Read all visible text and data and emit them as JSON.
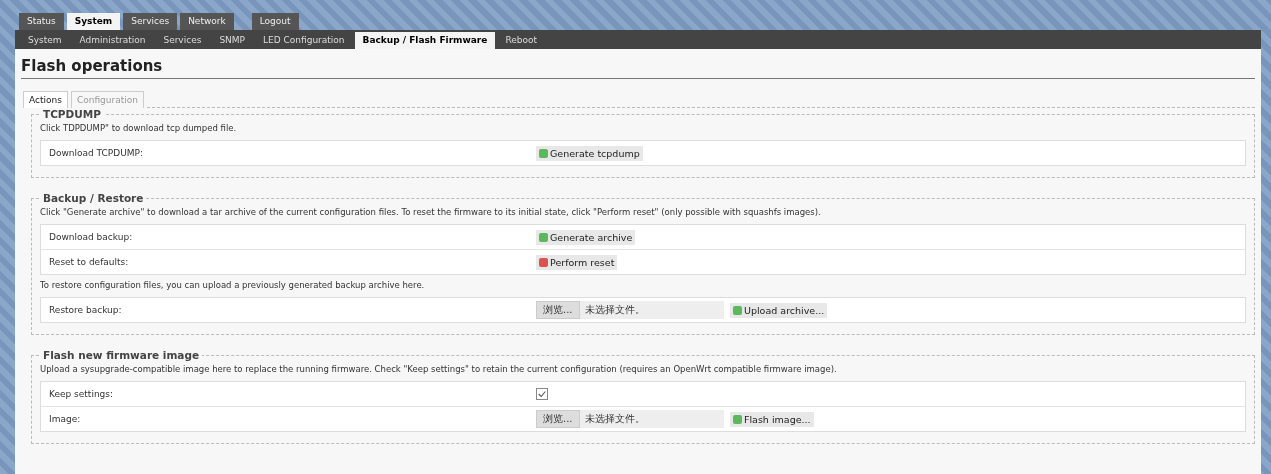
{
  "main_menu": [
    {
      "label": "Status",
      "selected": false
    },
    {
      "label": "System",
      "selected": true
    },
    {
      "label": "Services",
      "selected": false
    },
    {
      "label": "Network",
      "selected": false
    },
    {
      "label": "Logout",
      "selected": false
    }
  ],
  "sub_menu": [
    {
      "label": "System",
      "selected": false
    },
    {
      "label": "Administration",
      "selected": false
    },
    {
      "label": "Services",
      "selected": false
    },
    {
      "label": "SNMP",
      "selected": false
    },
    {
      "label": "LED Configuration",
      "selected": false
    },
    {
      "label": "Backup / Flash Firmware",
      "selected": true
    },
    {
      "label": "Reboot",
      "selected": false
    }
  ],
  "title": "Flash operations",
  "tabs": [
    {
      "label": "Actions",
      "selected": true
    },
    {
      "label": "Configuration",
      "selected": false
    }
  ],
  "sections": [
    {
      "legend": "TCPDUMP",
      "blocks": [
        {
          "kind": "text",
          "text": "Click TDPDUMP\" to download tcp dumped file."
        },
        {
          "kind": "table",
          "rows": [
            {
              "label": "Download TCPDUMP:",
              "kind": "button",
              "button": {
                "label": "Generate tcpdump",
                "color": "#5cb85c"
              }
            }
          ]
        }
      ]
    },
    {
      "legend": "Backup / Restore",
      "blocks": [
        {
          "kind": "text",
          "text": "Click \"Generate archive\" to download a tar archive of the current configuration files. To reset the firmware to its initial state, click \"Perform reset\" (only possible with squashfs images)."
        },
        {
          "kind": "table",
          "rows": [
            {
              "label": "Download backup:",
              "kind": "button",
              "button": {
                "label": "Generate archive",
                "color": "#5cb85c"
              }
            },
            {
              "label": "Reset to defaults:",
              "kind": "button",
              "button": {
                "label": "Perform reset",
                "color": "#d9534f"
              }
            }
          ]
        },
        {
          "kind": "text",
          "text": "To restore configuration files, you can upload a previously generated backup archive here."
        },
        {
          "kind": "table",
          "rows": [
            {
              "label": "Restore backup:",
              "kind": "file",
              "browse": "浏览...",
              "file_status": "未选择文件。",
              "button": {
                "label": "Upload archive...",
                "color": "#5cb85c"
              }
            }
          ]
        }
      ]
    },
    {
      "legend": "Flash new firmware image",
      "blocks": [
        {
          "kind": "text",
          "text": "Upload a sysupgrade-compatible image here to replace the running firmware. Check \"Keep settings\" to retain the current configuration (requires an OpenWrt compatible firmware image)."
        },
        {
          "kind": "table",
          "rows": [
            {
              "label": "Keep settings:",
              "kind": "checkbox",
              "checked": true
            },
            {
              "label": "Image:",
              "kind": "file",
              "browse": "浏览...",
              "file_status": "未选择文件。",
              "button": {
                "label": "Flash image...",
                "color": "#5cb85c"
              }
            }
          ]
        }
      ]
    }
  ]
}
